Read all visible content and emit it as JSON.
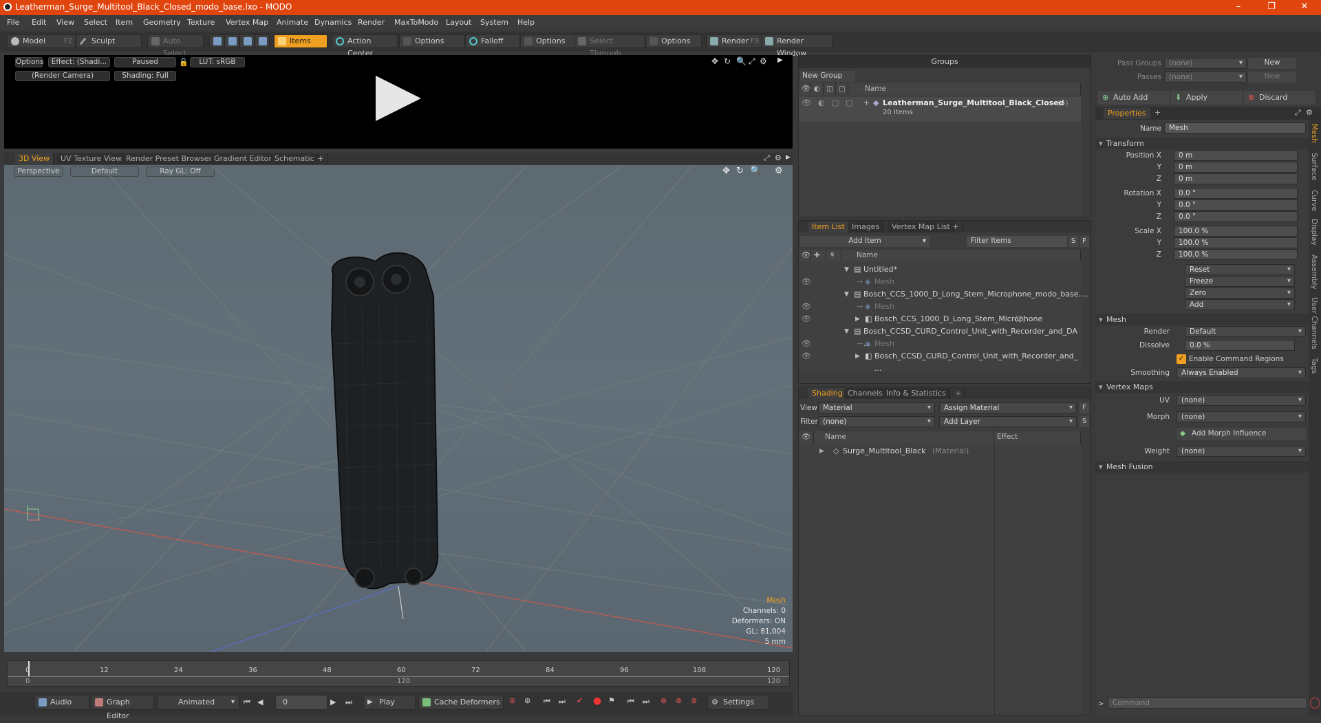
{
  "window": {
    "title": "Leatherman_Surge_Multitool_Black_Closed_modo_base.lxo - MODO",
    "minimize": "–",
    "maximize": "❐",
    "close": "✕"
  },
  "menu": [
    "File",
    "Edit",
    "View",
    "Select",
    "Item",
    "Geometry",
    "Texture",
    "Vertex Map",
    "Animate",
    "Dynamics",
    "Render",
    "MaxToModo",
    "Layout",
    "System",
    "Help"
  ],
  "toolbar": {
    "model": "Model",
    "model_key": "F2",
    "sculpt": "Sculpt",
    "auto_select": "Auto Select",
    "items": "Items",
    "action_center": "Action Center",
    "options": "Options",
    "falloff": "Falloff",
    "options2": "Options",
    "select_through": "Select Through",
    "options3": "Options",
    "render": "Render",
    "render_key": "F9",
    "render_window": "Render Window"
  },
  "preview": {
    "options": "Options",
    "effect": "Effect: (Shadi...",
    "paused": "Paused",
    "lut": "LUT: sRGB",
    "camera": "(Render Camera)",
    "shading": "Shading: Full"
  },
  "viewtabs": [
    "3D View",
    "UV Texture View",
    "Render Preset Browser",
    "Gradient Editor",
    "Schematic",
    "+"
  ],
  "viewport": {
    "perspective": "Perspective",
    "default": "Default",
    "raygl": "Ray GL: Off",
    "info_title": "Mesh",
    "channels": "Channels: 0",
    "deformers": "Deformers: ON",
    "gl": "GL: 81,004",
    "scale": "5 mm"
  },
  "timeline": {
    "ticks": [
      "0",
      "12",
      "24",
      "36",
      "48",
      "60",
      "72",
      "84",
      "96",
      "108",
      "120"
    ],
    "mid": "120",
    "end": "120"
  },
  "bottom": {
    "audio": "Audio",
    "graph": "Graph Editor",
    "animated": "Animated",
    "frame": "0",
    "play": "Play",
    "cache": "Cache Deformers",
    "settings": "Settings"
  },
  "groups": {
    "title": "Groups",
    "new_group": "New Group",
    "col_name": "Name",
    "item": "Leatherman_Surge_Multitool_Black_Closed",
    "item_count": "(4)",
    "item_sub": "20 Items"
  },
  "itemlist": {
    "tabs": [
      "Item List",
      "Images",
      "Vertex Map List",
      "+"
    ],
    "add_item": "Add Item",
    "filter": "Filter Items",
    "col_name": "Name",
    "rows": [
      {
        "label": "Untitled*",
        "indent": 1,
        "type": "scene"
      },
      {
        "label": "Mesh",
        "indent": 2,
        "type": "mesh"
      },
      {
        "label": "Bosch_CCS_1000_D_Long_Stem_Microphone_modo_base....",
        "indent": 1,
        "type": "scene"
      },
      {
        "label": "Mesh",
        "indent": 2,
        "type": "mesh"
      },
      {
        "label": "Bosch_CCS_1000_D_Long_Stem_Microphone",
        "count": "(2)",
        "indent": 2,
        "type": "group"
      },
      {
        "label": "Bosch_CCSD_CURD_Control_Unit_with_Recorder_and_DA ...",
        "indent": 1,
        "type": "scene"
      },
      {
        "label": "Mesh",
        "indent": 2,
        "type": "mesh"
      },
      {
        "label": "Bosch_CCSD_CURD_Control_Unit_with_Recorder_and_ ...",
        "indent": 2,
        "type": "group"
      }
    ]
  },
  "shading": {
    "tabs": [
      "Shading",
      "Channels",
      "Info & Statistics",
      "+"
    ],
    "view_label": "View",
    "view_val": "Material",
    "assign": "Assign Material",
    "filter_label": "Filter",
    "filter_val": "(none)",
    "add_layer": "Add Layer",
    "col_name": "Name",
    "col_effect": "Effect",
    "mat": "Surge_Multitool_Black",
    "mat_type": "(Material)"
  },
  "right": {
    "pass_groups": "Pass Groups",
    "passes": "Passes",
    "none": "(none)",
    "new": "New",
    "auto_add": "Auto Add",
    "apply": "Apply",
    "discard": "Discard",
    "properties": "Properties",
    "name_label": "Name",
    "name_val": "Mesh",
    "transform": "Transform",
    "pos_x": "Position X",
    "y": "Y",
    "z": "Z",
    "rot_x": "Rotation X",
    "scale_x": "Scale X",
    "zero_m": "0 m",
    "zero_deg": "0.0 °",
    "hundred": "100.0 %",
    "reset": "Reset",
    "freeze": "Freeze",
    "zero": "Zero",
    "add": "Add",
    "mesh_sect": "Mesh",
    "render": "Render",
    "render_val": "Default",
    "dissolve": "Dissolve",
    "dissolve_val": "0.0 %",
    "enable_cmd": "Enable Command Regions",
    "smoothing": "Smoothing",
    "smoothing_val": "Always Enabled",
    "vmaps": "Vertex Maps",
    "uv": "UV",
    "morph": "Morph",
    "add_morph": "Add Morph Influence",
    "weight": "Weight",
    "mesh_fusion": "Mesh Fusion",
    "command": "Command",
    "side_tabs": [
      "Mesh",
      "Surface",
      "Curve",
      "Display",
      "Assembly",
      "User Channels",
      "Tags"
    ]
  },
  "colors": {
    "accent": "#f0a020",
    "title": "#e0450e"
  }
}
